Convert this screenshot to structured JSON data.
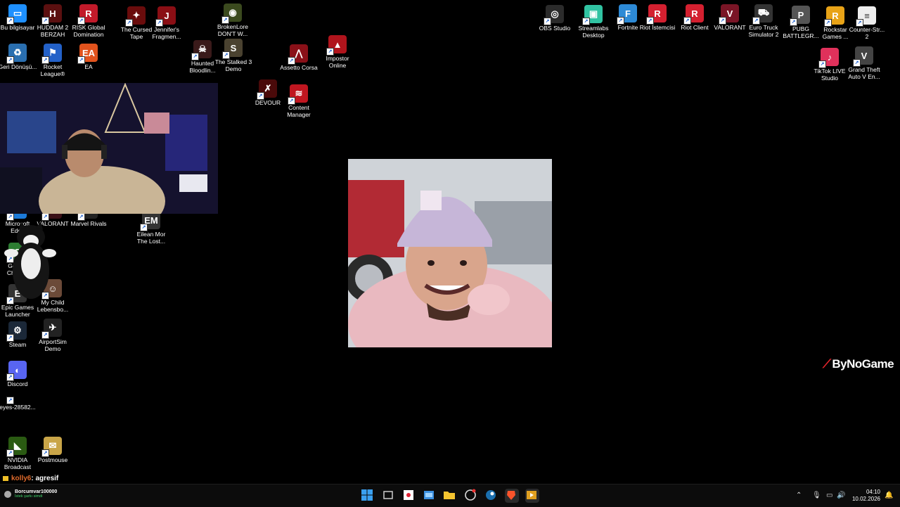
{
  "desktop_icons": [
    {
      "label": "Bu bilgisayar",
      "color": "#1e90ff",
      "glyph": "▭",
      "icon": "computer-icon"
    },
    {
      "label": "HUDDAM 2 BERZAH",
      "color": "#5b1010",
      "glyph": "H",
      "icon": "huddam-icon"
    },
    {
      "label": "RISK Global Domination",
      "color": "#c21a2a",
      "glyph": "R",
      "icon": "risk-icon"
    },
    {
      "label": "The Cursed Tape",
      "color": "#6a0c0c",
      "glyph": "✦",
      "icon": "cursed-tape-icon"
    },
    {
      "label": "Jennifer's Fragmen...",
      "color": "#8a0e14",
      "glyph": "J",
      "icon": "jennifer-icon"
    },
    {
      "label": "BrokenLore DON'T W...",
      "color": "#3b4a1e",
      "glyph": "◉",
      "icon": "brokenlore-icon"
    },
    {
      "label": "Geri Dönüşü...",
      "color": "#2a6fb0",
      "glyph": "♻",
      "icon": "recycle-bin-icon"
    },
    {
      "label": "Rocket League®",
      "color": "#2361c8",
      "glyph": "⚑",
      "icon": "rocket-league-icon"
    },
    {
      "label": "EA",
      "color": "#e2531d",
      "glyph": "EA",
      "icon": "ea-icon"
    },
    {
      "label": "Haunted Bloodlin...",
      "color": "#3a1a1a",
      "glyph": "☠",
      "icon": "haunted-icon"
    },
    {
      "label": "The Stalked 3 Demo",
      "color": "#4a4230",
      "glyph": "S",
      "icon": "stalked-icon"
    },
    {
      "label": "Assetto Corsa",
      "color": "#8a1018",
      "glyph": "⋀",
      "icon": "assetto-corsa-icon"
    },
    {
      "label": "Impostor Online",
      "color": "#b0141c",
      "glyph": "▲",
      "icon": "impostor-icon"
    },
    {
      "label": "DEVOUR",
      "color": "#4a0a0a",
      "glyph": "✗",
      "icon": "devour-icon"
    },
    {
      "label": "Content Manager",
      "color": "#c01620",
      "glyph": "≋",
      "icon": "content-manager-icon"
    },
    {
      "label": "Microsoft Edge",
      "color": "#1c7ad8",
      "glyph": "e",
      "icon": "edge-icon"
    },
    {
      "label": "VALORANT",
      "color": "#3a1017",
      "glyph": "V",
      "icon": "valorant-small-icon"
    },
    {
      "label": "Marvel Rivals",
      "color": "#222",
      "glyph": "M",
      "icon": "marvel-rivals-icon"
    },
    {
      "label": "Eilean Mor The Lost...",
      "color": "#333",
      "glyph": "EM",
      "icon": "eilean-mor-icon"
    },
    {
      "label": "Google Chrome",
      "color": "#2d7d32",
      "glyph": "G",
      "icon": "chrome-icon"
    },
    {
      "label": "Epic Games Launcher",
      "color": "#333",
      "glyph": "E",
      "icon": "epic-games-icon"
    },
    {
      "label": "My Child Lebensbo...",
      "color": "#6b4a38",
      "glyph": "☺",
      "icon": "my-child-icon"
    },
    {
      "label": "Steam",
      "color": "#1b2838",
      "glyph": "⚙",
      "icon": "steam-icon"
    },
    {
      "label": "AirportSim Demo",
      "color": "#222",
      "glyph": "✈",
      "icon": "airportsim-icon"
    },
    {
      "label": "Discord",
      "color": "#5865f2",
      "glyph": "◐",
      "icon": "discord-icon"
    },
    {
      "label": "eyes-28582...",
      "color": "#000",
      "glyph": "",
      "icon": "file-icon"
    },
    {
      "label": "NVIDIA Broadcast",
      "color": "#2a5a12",
      "glyph": "◣",
      "icon": "nvidia-broadcast-icon"
    },
    {
      "label": "Postmouse",
      "color": "#c9a548",
      "glyph": "✉",
      "icon": "postmouse-icon"
    },
    {
      "label": "OBS Studio",
      "color": "#2b2b2b",
      "glyph": "◎",
      "icon": "obs-icon"
    },
    {
      "label": "Streamlabs Desktop",
      "color": "#31c3a2",
      "glyph": "▣",
      "icon": "streamlabs-icon"
    },
    {
      "label": "Fortnite",
      "color": "#2d8ad6",
      "glyph": "F",
      "icon": "fortnite-icon"
    },
    {
      "label": "Riot İstemcisi",
      "color": "#d42030",
      "glyph": "R",
      "icon": "riot-istemcisi-icon"
    },
    {
      "label": "Riot Client",
      "color": "#d42030",
      "glyph": "R",
      "icon": "riot-client-icon"
    },
    {
      "label": "VALORANT",
      "color": "#7a1526",
      "glyph": "V",
      "icon": "valorant-icon"
    },
    {
      "label": "Euro Truck Simulator 2",
      "color": "#333",
      "glyph": "⛟",
      "icon": "euro-truck-icon"
    },
    {
      "label": "PUBG BATTLEGR...",
      "color": "#555",
      "glyph": "P",
      "icon": "pubg-icon"
    },
    {
      "label": "Rockstar Games ...",
      "color": "#e8a317",
      "glyph": "R",
      "icon": "rockstar-icon"
    },
    {
      "label": "Counter-Str... 2",
      "color": "#eee",
      "glyph": "≡",
      "icon": "counter-strike-icon"
    },
    {
      "label": "TikTok LIVE Studio",
      "color": "#e0315b",
      "glyph": "♪",
      "icon": "tiktok-live-icon"
    },
    {
      "label": "Grand Theft Auto V En...",
      "color": "#444",
      "glyph": "V",
      "icon": "gta-icon"
    }
  ],
  "overlay": {
    "brand": "ByNoGame",
    "chat_user": "kolly6",
    "chat_message": ": agresif"
  },
  "taskbar": {
    "weather_title": "Borcumvar100000",
    "weather_sub": "İstek şarkı simdi",
    "time": "04:10",
    "date": "10.02.2026"
  }
}
